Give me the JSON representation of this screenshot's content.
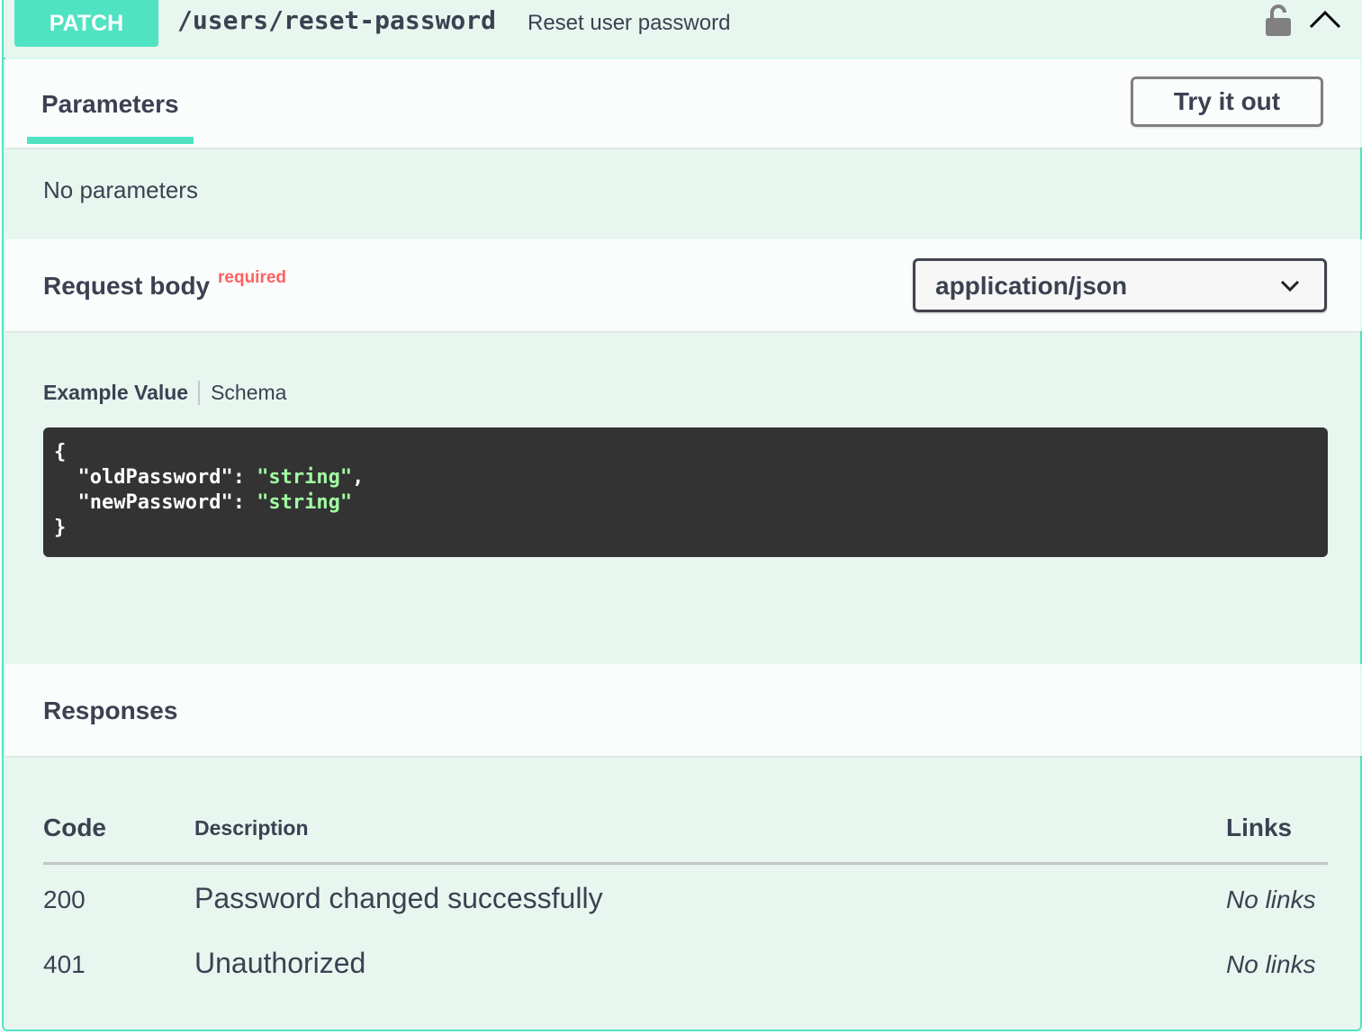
{
  "operation": {
    "method": "PATCH",
    "path": "/users/reset-password",
    "summary": "Reset user password",
    "accent_color": "#50e3c2",
    "icons": {
      "lock": "lock-open-icon",
      "collapse": "chevron-up-icon"
    }
  },
  "parameters": {
    "tab_label": "Parameters",
    "try_label": "Try it out",
    "empty_text": "No parameters"
  },
  "request_body": {
    "title": "Request body",
    "required_label": "required",
    "content_type": "application/json",
    "tabs": {
      "example": "Example Value",
      "schema": "Schema"
    },
    "example": {
      "open": "{",
      "key1": "\"oldPassword\"",
      "val1": "\"string\"",
      "key2": "\"newPassword\"",
      "val2": "\"string\"",
      "close": "}"
    }
  },
  "responses": {
    "title": "Responses",
    "headers": {
      "code": "Code",
      "description": "Description",
      "links": "Links"
    },
    "rows": [
      {
        "code": "200",
        "description": "Password changed successfully",
        "links": "No links"
      },
      {
        "code": "401",
        "description": "Unauthorized",
        "links": "No links"
      }
    ]
  }
}
